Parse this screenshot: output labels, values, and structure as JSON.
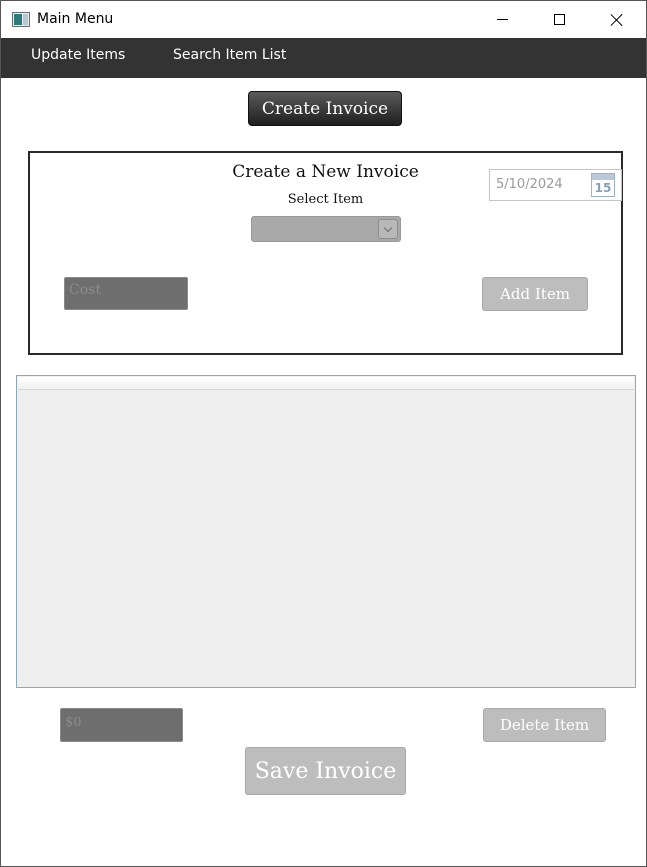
{
  "window": {
    "title": "Main Menu",
    "icon": "app-window-icon"
  },
  "menu": {
    "items": [
      {
        "label": "Update Items"
      },
      {
        "label": "Search Item List"
      }
    ]
  },
  "toolbar": {
    "create_invoice_label": "Create Invoice"
  },
  "invoice_panel": {
    "title": "Create a New Invoice",
    "select_label": "Select Item",
    "select_value": "",
    "date_value": "5/10/2024",
    "calendar_day": "15",
    "cost_placeholder": "Cost",
    "add_item_label": "Add Item"
  },
  "items_table": {
    "columns": [],
    "rows": []
  },
  "footer": {
    "total_placeholder": "$0",
    "delete_item_label": "Delete Item",
    "save_invoice_label": "Save Invoice"
  }
}
